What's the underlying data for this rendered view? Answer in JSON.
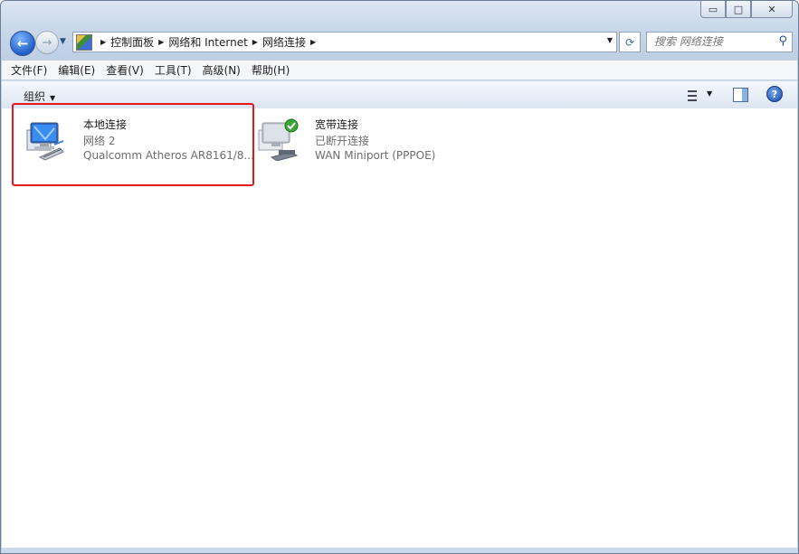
{
  "window": {
    "caption_min": "▭",
    "caption_max": "□",
    "caption_close": "✕"
  },
  "nav": {
    "back_icon": "back-arrow-icon",
    "forward_icon": "forward-arrow-icon",
    "breadcrumbs": [
      "控制面板",
      "网络和 Internet",
      "网络连接"
    ],
    "search_placeholder": "搜索 网络连接"
  },
  "menubar": {
    "items": [
      "文件(F)",
      "编辑(E)",
      "查看(V)",
      "工具(T)",
      "高级(N)",
      "帮助(H)"
    ]
  },
  "cmdbar": {
    "organize_label": "组织",
    "help_label": "?"
  },
  "connections": [
    {
      "name": "本地连接",
      "status": "网络  2",
      "device": "Qualcomm Atheros AR8161/8...",
      "icon": "lan-connection-icon",
      "selected_highlight": true
    },
    {
      "name": "宽带连接",
      "status": "已断开连接",
      "device": "WAN Miniport (PPPOE)",
      "icon": "broadband-connection-icon",
      "badge": "green-check-icon"
    }
  ],
  "colors": {
    "highlight_border": "#e8191c",
    "accent_blue": "#1f5fc7"
  }
}
